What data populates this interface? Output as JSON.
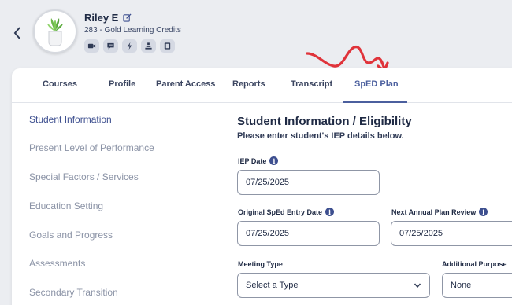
{
  "student": {
    "name": "Riley E",
    "subtitle": "283 - Gold Learning Credits"
  },
  "quick_icons": [
    "video-icon",
    "chat-icon",
    "bolt-icon",
    "stack-icon",
    "film-icon"
  ],
  "tabs": [
    {
      "label": "Courses"
    },
    {
      "label": "Profile"
    },
    {
      "label": "Parent Access"
    },
    {
      "label": "Reports"
    },
    {
      "label": "Transcript"
    },
    {
      "label": "SpED Plan",
      "active": true
    }
  ],
  "sidebar": [
    {
      "label": "Student Information",
      "active": true
    },
    {
      "label": "Present Level of Performance"
    },
    {
      "label": "Special Factors / Services"
    },
    {
      "label": "Education Setting"
    },
    {
      "label": "Goals and Progress"
    },
    {
      "label": "Assessments"
    },
    {
      "label": "Secondary Transition"
    }
  ],
  "form": {
    "title": "Student Information / Eligibility",
    "subtitle": "Please enter student's IEP details below.",
    "iep_date": {
      "label": "IEP Date",
      "value": "07/25/2025"
    },
    "entry_date": {
      "label": "Original SpEd Entry Date",
      "value": "07/25/2025"
    },
    "annual_review": {
      "label": "Next Annual Plan Review",
      "value": "07/25/2025"
    },
    "meeting_type": {
      "label": "Meeting Type",
      "value": "Select a Type"
    },
    "additional_purpose": {
      "label": "Additional Purpose",
      "value": "None"
    }
  },
  "colors": {
    "accent": "#3d4f8f",
    "annotation": "#e0333a",
    "background": "#ebedf1"
  }
}
